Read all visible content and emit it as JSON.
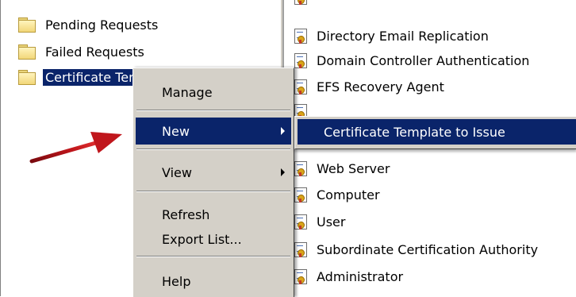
{
  "tree": {
    "items": [
      {
        "label": "Pending Requests"
      },
      {
        "label": "Failed Requests"
      },
      {
        "label": "Certificate Templates"
      }
    ]
  },
  "list": {
    "items": [
      {
        "label": "Directory Email Replication"
      },
      {
        "label": "Domain Controller Authentication"
      },
      {
        "label": "EFS Recovery Agent"
      },
      {
        "label": "Web Server"
      },
      {
        "label": "Computer"
      },
      {
        "label": "User"
      },
      {
        "label": "Subordinate Certification Authority"
      },
      {
        "label": "Administrator"
      }
    ]
  },
  "context_menu": {
    "manage": "Manage",
    "new": "New",
    "view": "View",
    "refresh": "Refresh",
    "export_list": "Export List...",
    "help": "Help"
  },
  "submenu": {
    "certificate_template_to_issue": "Certificate Template to Issue"
  },
  "colors": {
    "highlight": "#0a246a",
    "menu_face": "#d4d0c8",
    "annotation_arrow": "#c0161c"
  }
}
